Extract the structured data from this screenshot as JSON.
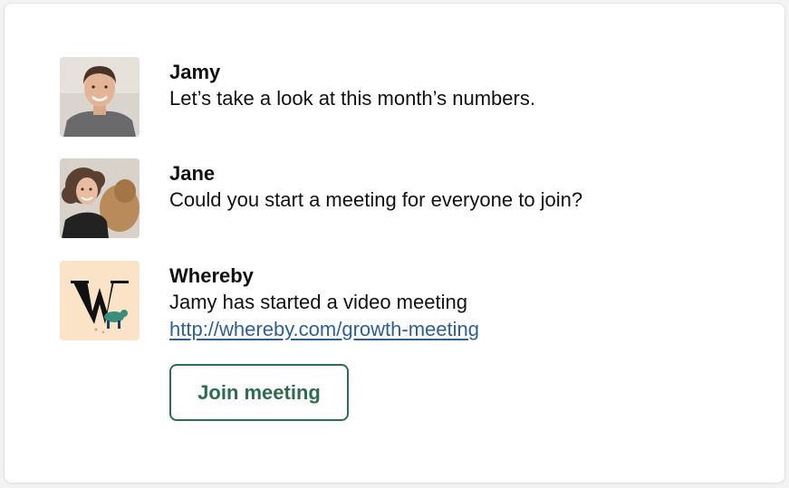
{
  "messages": [
    {
      "avatar": "jamy-avatar",
      "author": "Jamy",
      "text": "Let’s take a look at this month’s numbers."
    },
    {
      "avatar": "jane-avatar",
      "author": "Jane",
      "text": "Could you start a meeting for everyone to join?"
    },
    {
      "avatar": "whereby-logo",
      "author": "Whereby",
      "text": "Jamy has started a video meeting",
      "link": "http://whereby.com/growth-meeting",
      "button_label": "Join meeting"
    }
  ],
  "colors": {
    "link": "#2f5f93",
    "button_accent": "#2f6b4f",
    "whereby_bg": "#fbe3c7"
  }
}
